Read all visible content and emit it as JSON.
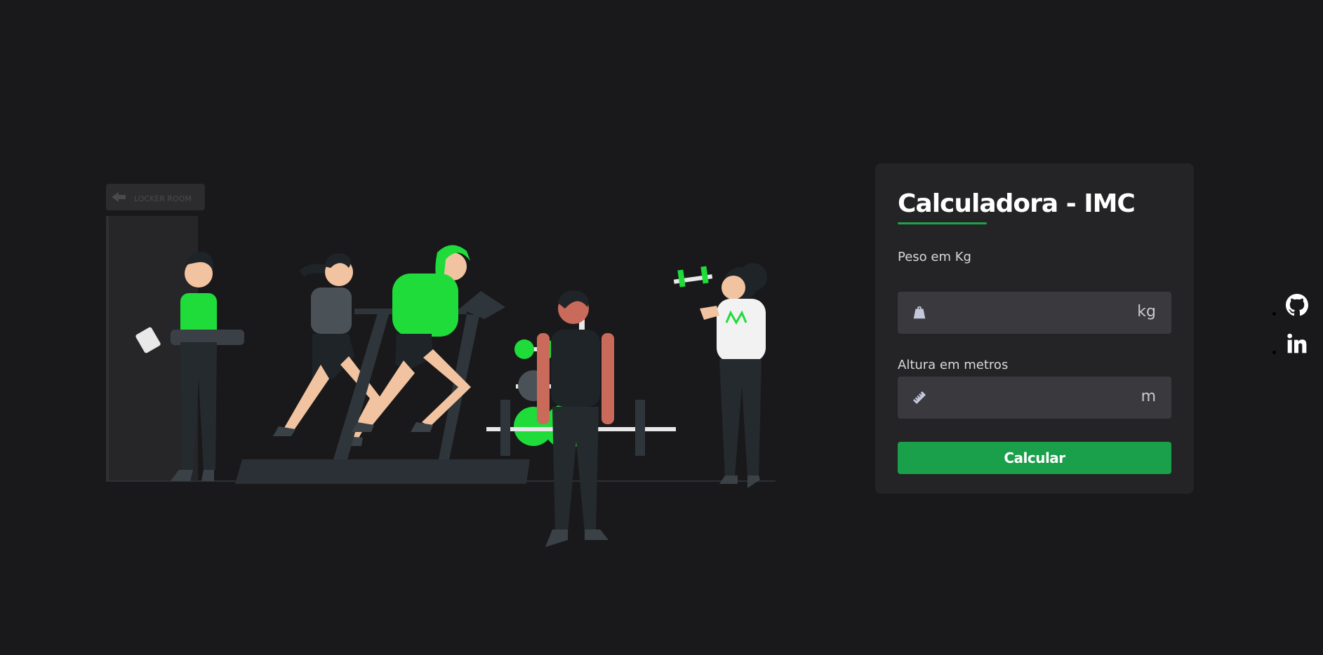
{
  "illustration": {
    "sign_text": "LOCKER ROOM",
    "accent_color": "#1fdc3a"
  },
  "card": {
    "title": "Calculadora - IMC",
    "weight_label": "Peso em Kg",
    "weight_unit": "kg",
    "weight_icon": "weight-icon",
    "weight_value": "",
    "height_label": "Altura em metros",
    "height_unit": "m",
    "height_icon": "ruler-icon",
    "height_value": "",
    "button_label": "Calcular",
    "accent_color": "#1a9f4a"
  },
  "socials": [
    {
      "name": "github",
      "icon": "github-icon"
    },
    {
      "name": "linkedin",
      "icon": "linkedin-icon"
    }
  ]
}
